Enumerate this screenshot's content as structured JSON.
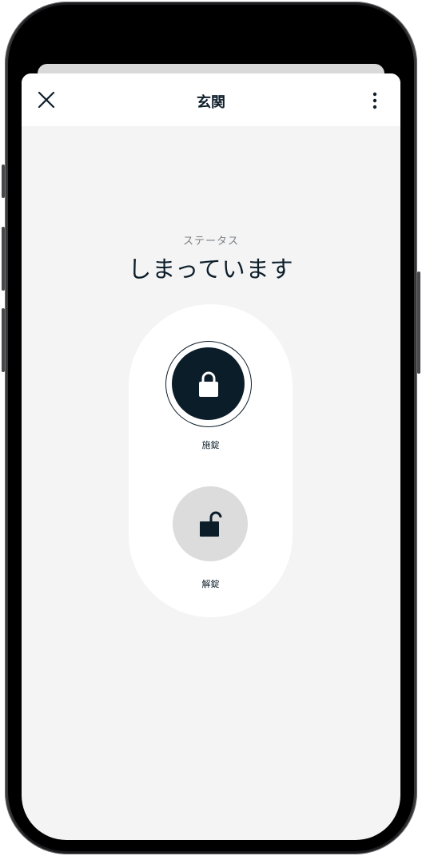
{
  "header": {
    "title": "玄関",
    "close_icon": "close-icon",
    "more_icon": "more-vertical-icon"
  },
  "status": {
    "label": "ステータス",
    "value": "しまっています"
  },
  "controls": {
    "lock": {
      "label": "施錠",
      "icon": "lock-closed-icon",
      "selected": true
    },
    "unlock": {
      "label": "解錠",
      "icon": "lock-open-icon",
      "selected": false
    }
  },
  "colors": {
    "primary": "#0c1d2a",
    "background": "#f4f4f4",
    "inactive_button": "#dcdcdc",
    "status_label": "#7a7f85"
  }
}
